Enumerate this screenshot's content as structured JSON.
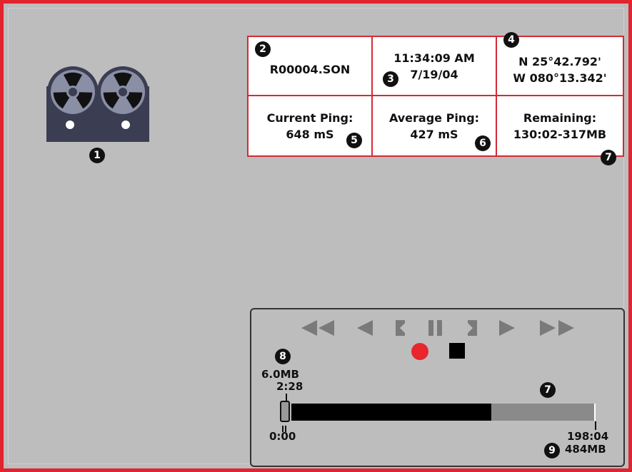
{
  "colors": {
    "frame": "#e0252f",
    "background": "#bdbdbd",
    "grid_border": "#d22b35",
    "reel_body": "#3b3d52",
    "reel_disc": "#8a8fa6",
    "control_grey": "#7a7a7a",
    "record_red": "#e8262b",
    "progress_filled": "#000000",
    "progress_track": "#8a8a8a"
  },
  "icons": {
    "reel": "tape-reel-recorder-icon",
    "rewind": "fast-rewind-icon",
    "step_back": "step-back-icon",
    "mark_start": "mark-start-bracket-icon",
    "pause": "pause-icon",
    "mark_end": "mark-end-bracket-icon",
    "step_forward": "step-forward-icon",
    "fast_forward": "fast-forward-icon",
    "record": "record-icon",
    "stop": "stop-icon"
  },
  "callouts": {
    "reel": "1",
    "filename": "2",
    "date": "3",
    "position": "4",
    "current_ping": "5",
    "average_ping": "6",
    "remaining": "7",
    "progress_bar": "7",
    "slider_position": "8",
    "total": "9"
  },
  "info": {
    "filename": "R00004.SON",
    "time": "11:34:09 AM",
    "date": "7/19/04",
    "lat": "N 25°42.792'",
    "lon": "W 080°13.342'",
    "current_ping_label": "Current Ping:",
    "current_ping_value": "648 mS",
    "average_ping_label": "Average Ping:",
    "average_ping_value": "427 mS",
    "remaining_label": "Remaining:",
    "remaining_value": "130:02-317MB"
  },
  "playback": {
    "slider_size": "6.0MB",
    "slider_time": "2:28",
    "start_time": "0:00",
    "end_time": "198:04",
    "end_size": "484MB",
    "recorded_fraction": 0.66
  }
}
